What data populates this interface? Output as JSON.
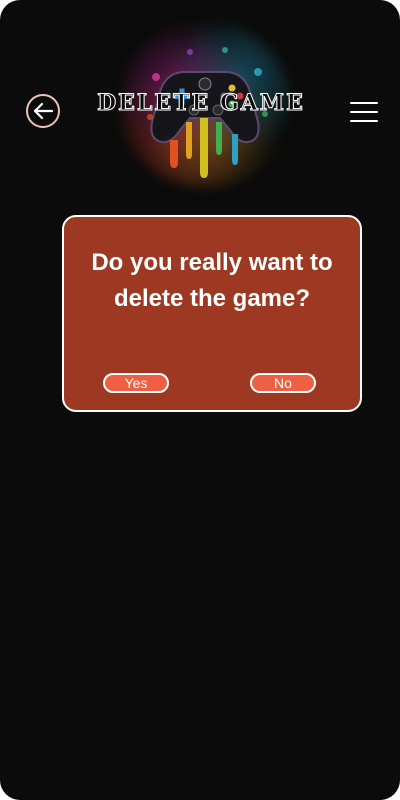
{
  "header": {
    "title": "DELETE GAME",
    "back_icon": "arrow-left-icon",
    "menu_icon": "hamburger-menu-icon",
    "logo": "gamepad-logo"
  },
  "dialog": {
    "message": "Do you really want to delete the game?",
    "yes_label": "Yes",
    "no_label": "No"
  },
  "colors": {
    "background": "#0b0b0b",
    "dialog_background": "#9d3822",
    "button_background": "#ee5f44",
    "text": "#ffffff"
  }
}
